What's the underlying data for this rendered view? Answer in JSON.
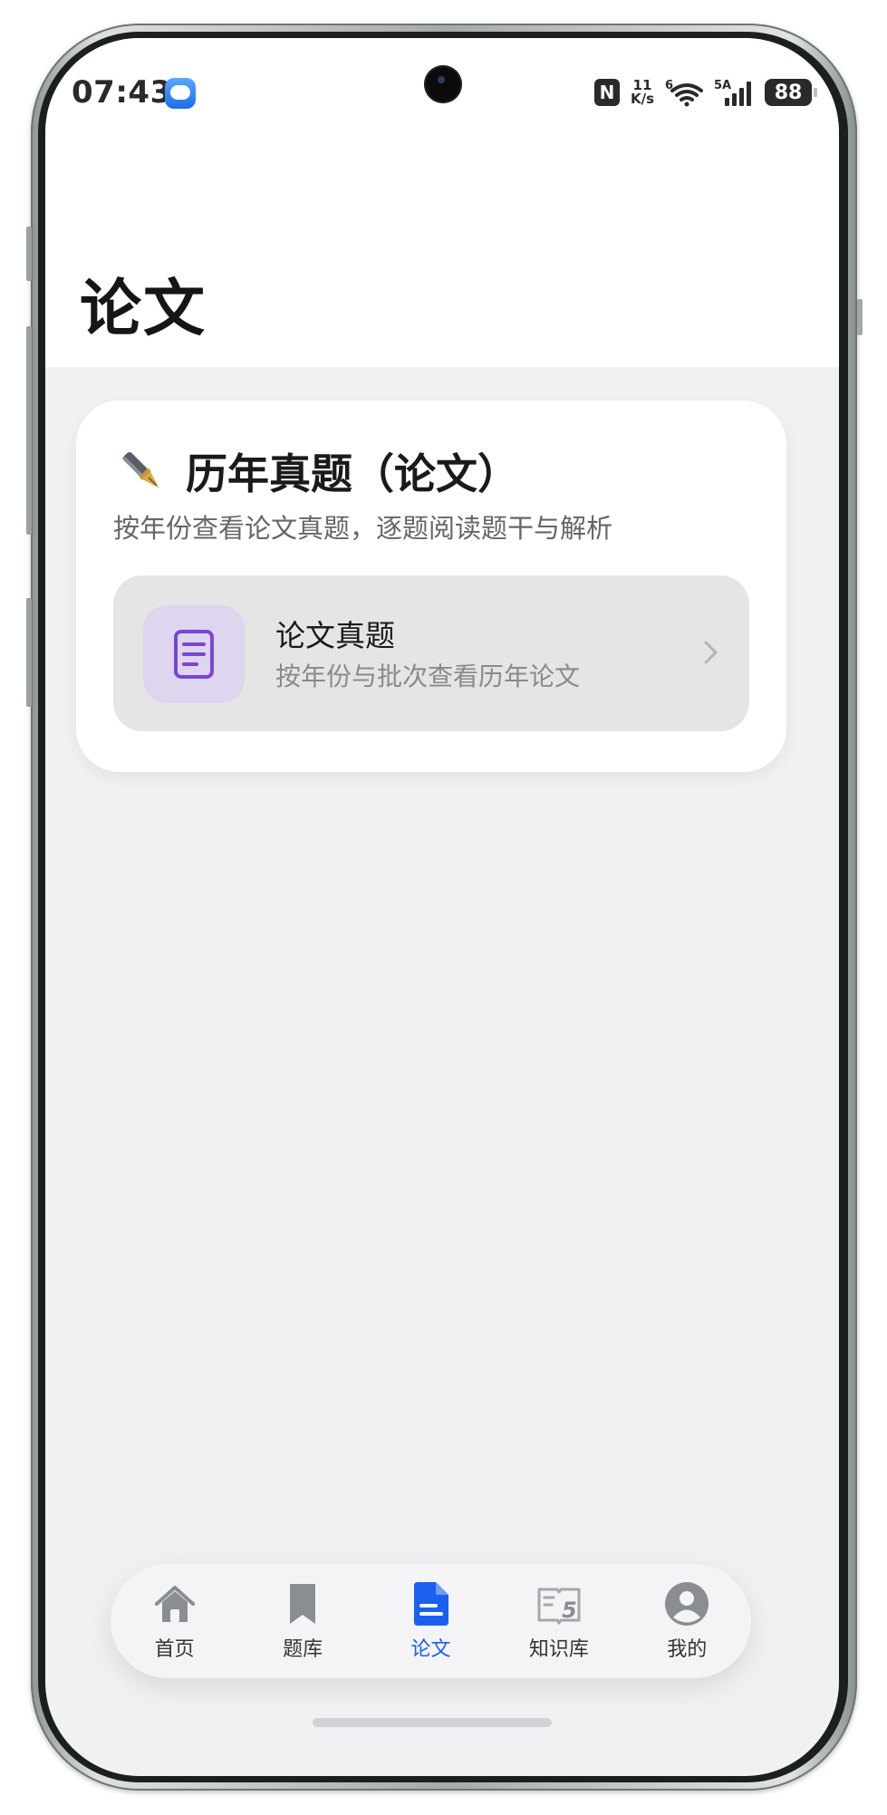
{
  "status_bar": {
    "time": "07:43",
    "nfc": "N",
    "speed_value": "11",
    "speed_unit": "K/s",
    "wifi_label": "6",
    "signal_label": "5A",
    "battery": "88",
    "icons": [
      "message-icon",
      "nfc-icon",
      "wifi-icon",
      "signal-icon",
      "battery-icon"
    ]
  },
  "page": {
    "title": "论文"
  },
  "card": {
    "icon": "fountain-pen-icon",
    "title": "历年真题（论文）",
    "subtitle": "按年份查看论文真题，逐题阅读题干与解析",
    "entry": {
      "icon": "document-icon",
      "title": "论文真题",
      "description": "按年份与批次查看历年论文"
    }
  },
  "tabbar": {
    "tabs": [
      {
        "label": "首页",
        "icon": "home-icon",
        "active": false
      },
      {
        "label": "题库",
        "icon": "bookmark-icon",
        "active": false
      },
      {
        "label": "论文",
        "icon": "document-icon",
        "active": true
      },
      {
        "label": "知识库",
        "icon": "book-icon",
        "active": false
      },
      {
        "label": "我的",
        "icon": "user-icon",
        "active": false
      }
    ]
  },
  "colors": {
    "accent": "#1a5ff0",
    "background": "#f0f1f3",
    "entry_icon_bg": "#ddd6ee",
    "entry_icon_fg": "#7a45d6"
  }
}
